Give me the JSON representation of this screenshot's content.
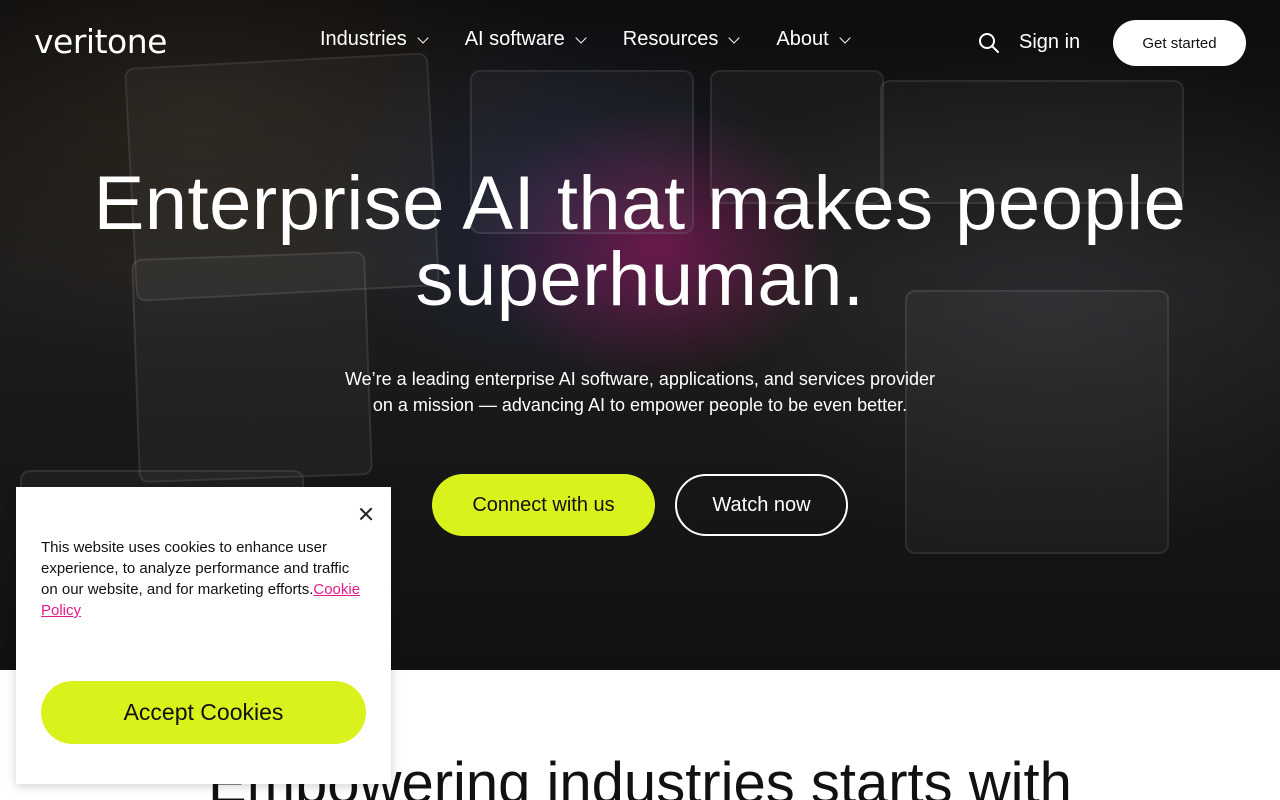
{
  "brand": {
    "logo_text": "veritone",
    "accent_color": "#d9f21c",
    "link_color": "#e6198a"
  },
  "nav": {
    "items": [
      {
        "label": "Industries"
      },
      {
        "label": "AI software"
      },
      {
        "label": "Resources"
      },
      {
        "label": "About"
      }
    ],
    "search_icon": "search-icon",
    "sign_in": "Sign in",
    "get_started": "Get started"
  },
  "hero": {
    "headline": "Enterprise AI that makes people superhuman.",
    "subtext": "We’re a leading enterprise AI software, applications, and services provider on a mission — advancing AI to empower people to be even better.",
    "primary_button": "Connect with us",
    "secondary_button": "Watch now"
  },
  "section": {
    "heading": "Empowering industries starts with"
  },
  "cookie_banner": {
    "text": "This website uses cookies to enhance user experience, to analyze performance and traffic on our website, and for marketing efforts.",
    "link_text": "Cookie Policy",
    "accept_label": "Accept Cookies",
    "close_icon": "close-icon"
  }
}
